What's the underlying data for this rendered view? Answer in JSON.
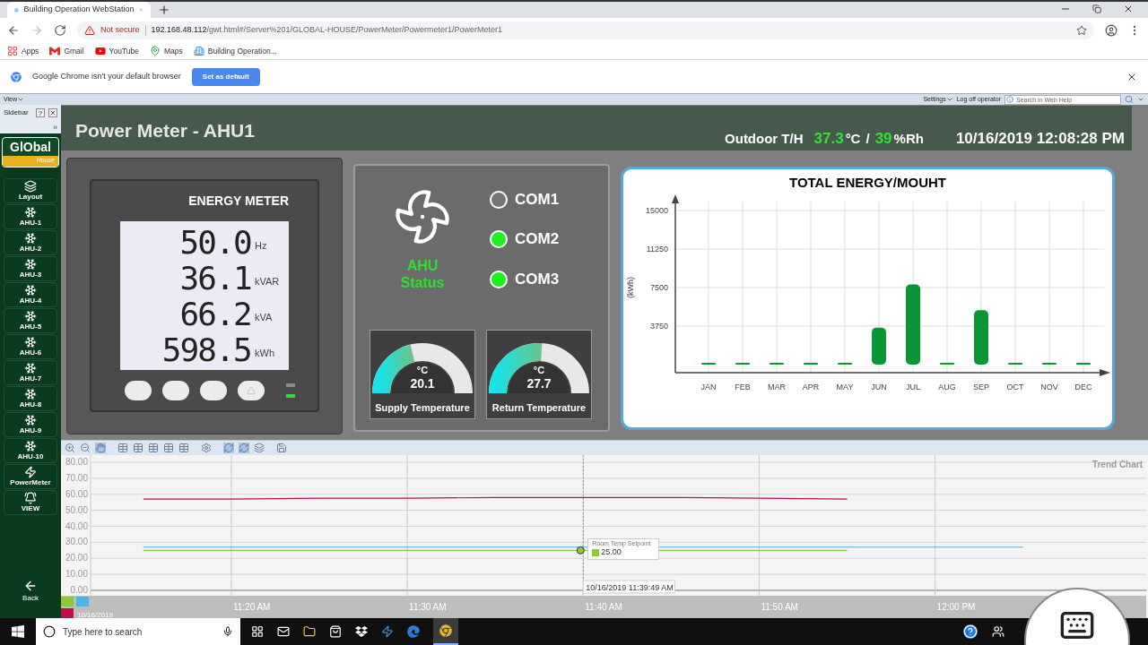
{
  "browser": {
    "tab_title": "Building Operation WebStation",
    "security": "Not secure",
    "url_host": "192.168.48.112",
    "url_path": "/gwt.html#/Server%201/GLOBAL-HOUSE/PowerMeter/Powermeter1/PowerMeter1",
    "bookmarks": [
      {
        "label": "Apps",
        "kind": "apps"
      },
      {
        "label": "Gmail",
        "kind": "gmail"
      },
      {
        "label": "YouTube",
        "kind": "youtube"
      },
      {
        "label": "Maps",
        "kind": "maps"
      },
      {
        "label": "Building Operation...",
        "kind": "site"
      }
    ],
    "infobar": {
      "message": "Google Chrome isn't your default browser",
      "button": "Set as default"
    }
  },
  "app_toolbar": {
    "view_menu": "View",
    "settings_menu": "Settings",
    "logoff": "Log off operator",
    "search_placeholder": "Search in Web Help"
  },
  "sidebar": {
    "title": "Sidebar",
    "help": "?",
    "expand": "»",
    "logo_main": "GlObal",
    "logo_sub": "House",
    "items": [
      {
        "label": "Layout",
        "kind": "layout"
      },
      {
        "label": "AHU-1",
        "kind": "ahu"
      },
      {
        "label": "AHU-2",
        "kind": "ahu"
      },
      {
        "label": "AHU-3",
        "kind": "ahu"
      },
      {
        "label": "AHU-4",
        "kind": "ahu"
      },
      {
        "label": "AHU-5",
        "kind": "ahu"
      },
      {
        "label": "AHU-6",
        "kind": "ahu"
      },
      {
        "label": "AHU-7",
        "kind": "ahu"
      },
      {
        "label": "AHU-8",
        "kind": "ahu"
      },
      {
        "label": "AHU-9",
        "kind": "ahu"
      },
      {
        "label": "AHU-10",
        "kind": "ahu"
      },
      {
        "label": "PowerMeter",
        "kind": "power"
      },
      {
        "label": "VIEW",
        "kind": "alarm"
      }
    ],
    "back": "Back"
  },
  "dashboard": {
    "title": "Power Meter - AHU1",
    "outdoor_label": "Outdoor T/H",
    "temperature": "37.3",
    "temp_unit": "°C",
    "separator": "/",
    "humidity": "39",
    "humidity_unit": "%Rh",
    "datetime": "10/16/2019 12:08:28 PM",
    "energy_meter": {
      "title": "ENERGY METER",
      "readings": [
        {
          "value": "50.0",
          "unit": "Hz"
        },
        {
          "value": "36.1",
          "unit": "kVAR"
        },
        {
          "value": "66.2",
          "unit": "kVA"
        },
        {
          "value": "598.5",
          "unit": "kWh"
        }
      ],
      "leds": [
        {
          "on": false
        },
        {
          "on": true
        }
      ]
    },
    "ahu": {
      "label": "AHU Status",
      "running": true
    },
    "coms": [
      {
        "label": "COM1",
        "on": false
      },
      {
        "label": "COM2",
        "on": true
      },
      {
        "label": "COM3",
        "on": true
      }
    ],
    "gauges": [
      {
        "unit": "°C",
        "value": "20.1",
        "label": "Supply Temperature",
        "level": 0.38
      },
      {
        "unit": "°C",
        "value": "27.7",
        "label": "Return Temperature",
        "level": 0.53
      }
    ],
    "energy_chart": {
      "chart_data": {
        "type": "bar",
        "title": "TOTAL ENERGY/MOUHT",
        "ylabel": "(kWh)",
        "categories": [
          "JAN",
          "FEB",
          "MAR",
          "APR",
          "MAY",
          "JUN",
          "JUL",
          "AUG",
          "SEP",
          "OCT",
          "NOV",
          "DEC"
        ],
        "series": [
          {
            "color": "#0a9636",
            "values": [
              0,
              0,
              0,
              0,
              0,
              3600,
              7800,
              0,
              5300,
              0,
              0,
              0
            ]
          }
        ],
        "ylim": [
          0,
          15000
        ],
        "yticks": [
          3750,
          7500,
          11250,
          15000
        ],
        "grid": true
      }
    }
  },
  "trend": {
    "title": "Trend Chart",
    "chart_data": {
      "type": "line",
      "grid": true,
      "categories": [
        null,
        "11:20 AM",
        null,
        "11:30 AM",
        null,
        "11:40 AM",
        null,
        "11:50 AM",
        null,
        "12:00 PM",
        null
      ],
      "ylim": [
        0,
        80
      ],
      "yticks": [
        {
          "value": 0,
          "label": "0.00"
        },
        {
          "value": 10,
          "label": "10.00"
        },
        {
          "value": 20,
          "label": "20.00"
        },
        {
          "value": 30,
          "label": "30.00"
        },
        {
          "value": 40,
          "label": "40.00"
        },
        {
          "value": 50,
          "label": "50.00"
        },
        {
          "value": 60,
          "label": "60.00"
        },
        {
          "value": 70,
          "label": "70.00"
        },
        {
          "value": 80,
          "label": "80.00"
        }
      ],
      "series": [
        {
          "name": "Room Temp Setpoint",
          "color": "#8dc63f",
          "values": [
            25,
            25,
            25,
            25,
            25,
            25,
            25,
            25,
            25,
            null,
            null
          ]
        },
        {
          "color": "#4fb3e8",
          "values": [
            27,
            27,
            27,
            27,
            27,
            27,
            27,
            27,
            27,
            27,
            27
          ]
        },
        {
          "color": "#c0104a",
          "values": [
            57,
            57,
            57.5,
            57.5,
            58,
            58,
            58,
            57.5,
            57,
            null,
            null
          ]
        }
      ]
    },
    "tooltip": {
      "value": "25.00"
    },
    "cursor_time": "10/16/2019 11:39:49 AM",
    "date": "10/16/2019",
    "legend": [
      {
        "color": "#8dc63f"
      },
      {
        "color": "#4fb3e8"
      },
      {
        "color": "#c0104a"
      }
    ]
  },
  "taskbar": {
    "search_placeholder": "Type here to search"
  }
}
